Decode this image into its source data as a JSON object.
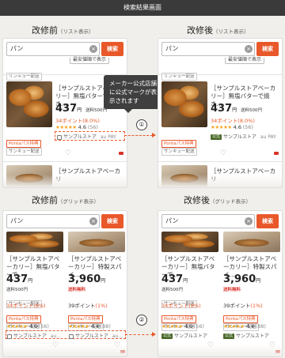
{
  "page_title": "検索結果画面",
  "sections": {
    "list_before": {
      "title": "改修前",
      "sub": "（リスト表示）"
    },
    "list_after": {
      "title": "改修後",
      "sub": "（リスト表示）"
    },
    "grid_before": {
      "title": "改修前",
      "sub": "（グリッド表示）"
    },
    "grid_after": {
      "title": "改修後",
      "sub": "（グリッド表示）"
    }
  },
  "search": {
    "value": "パン",
    "clear_icon": "×",
    "button": "検索"
  },
  "sort_chip": "最安値順で表示",
  "chips": {
    "sankyu": "サンキュー配送",
    "ponta": "Pontaパス特典",
    "official": "公式"
  },
  "tooltip": "メーカー公式店舗\nに公式マークが表\n示されます",
  "markers": {
    "one": "①",
    "two": "②"
  },
  "list_item": {
    "name_before": "［サンプルストアベーカリー］無塩バターで焼き…",
    "name_after": "［サンプルストアベーカリー］無塩バターで焼き…",
    "price": "437",
    "yen": "円",
    "shipping": "送料500円",
    "points": "34ポイント",
    "points_rate": "(8.0%)",
    "stars": "★★★★★",
    "rating": "4.6",
    "reviews": "(56)",
    "store": "サンプルストア",
    "pay": "au PAY"
  },
  "list_item2": {
    "name": "［サンプルストアベーカリ"
  },
  "grid_items": [
    {
      "name": "［サンプルストアベーカリー］無塩バターで…",
      "price": "437",
      "yen": "円",
      "shipping": "送料500円",
      "points": "34ポイント",
      "points_rate": "(8%)",
      "stars": "★★★★★",
      "rating": "4.6",
      "reviews": "(56)",
      "store": "サンプルストア",
      "pay": "au..."
    },
    {
      "name": "［サンプルストアベーカリー］特製スパイ…",
      "price": "3,960",
      "yen": "円",
      "shipping": "送料無料",
      "points": "39ポイント",
      "points_rate": "(1%)",
      "stars": "★★★★★",
      "rating": "4.4",
      "reviews": "(88)",
      "store": "サンプルストア",
      "pay": "au..."
    }
  ],
  "colors": {
    "accent": "#e8582a",
    "official_badge": "#4b6b2a",
    "star": "#f4a623"
  }
}
